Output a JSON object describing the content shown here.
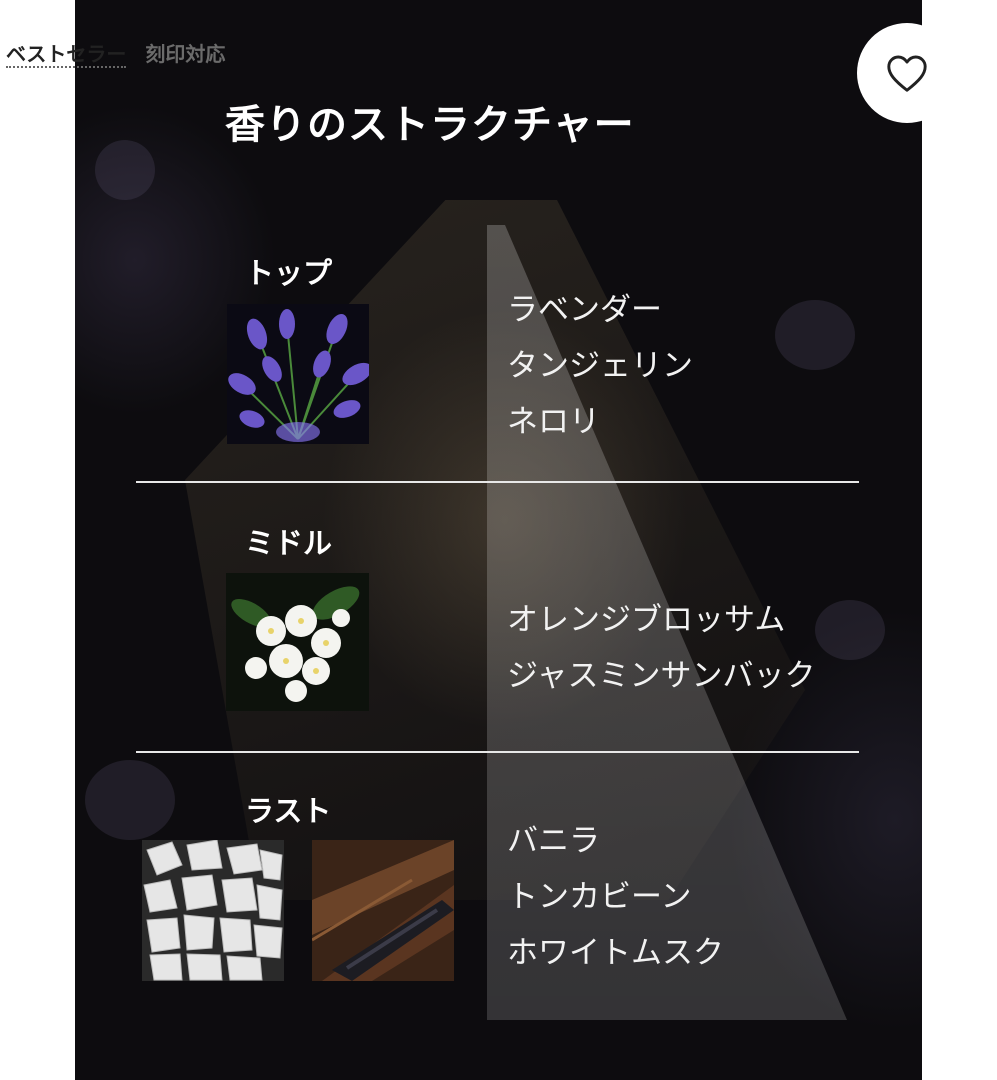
{
  "badges": {
    "bestseller": "ベストセラー",
    "engraving": "刻印対応"
  },
  "panel": {
    "title": "香りのストラクチャー",
    "sections": [
      {
        "label": "トップ",
        "notes": [
          "ラベンダー",
          "タンジェリン",
          "ネロリ"
        ],
        "image_icons": [
          "lavender-flower-image"
        ]
      },
      {
        "label": "ミドル",
        "notes": [
          "オレンジブロッサム",
          "ジャスミンサンバック"
        ],
        "image_icons": [
          "orange-blossom-image"
        ]
      },
      {
        "label": "ラスト",
        "notes": [
          "バニラ",
          "トンカビーン",
          "ホワイトムスク"
        ],
        "image_icons": [
          "white-musk-crystals-image",
          "vanilla-pod-image"
        ]
      }
    ]
  },
  "icons": {
    "favorite": "heart-outline-icon"
  },
  "colors": {
    "panel_bg": "#0d0c0f",
    "text": "#ffffff",
    "divider": "#e8e8e8",
    "lavender": "#6a56c8"
  }
}
